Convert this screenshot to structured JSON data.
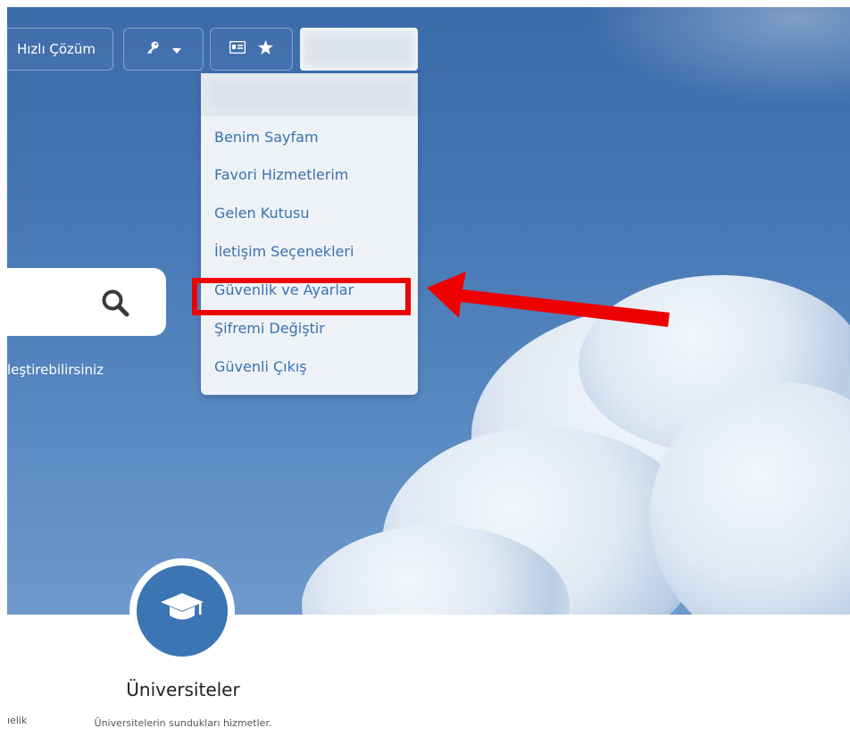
{
  "topbar": {
    "quick_solution_label": "Hızlı Çözüm",
    "key_icon": "key-icon",
    "caret_icon": "caret-down-icon",
    "id_card_icon": "id-card-icon",
    "star_icon": "star-icon"
  },
  "dropdown": {
    "items": [
      {
        "label": "Benim Sayfam"
      },
      {
        "label": "Favori Hizmetlerim"
      },
      {
        "label": "Gelen Kutusu"
      },
      {
        "label": "İletişim Seçenekleri"
      },
      {
        "label": "Güvenlik ve Ayarlar"
      },
      {
        "label": "Şifremi Değiştir"
      },
      {
        "label": "Güvenli Çıkış"
      }
    ],
    "highlighted_item": "Güvenlik ve Ayarlar"
  },
  "search": {
    "icon": "search-icon"
  },
  "hero": {
    "subtext_fragment": "leştirebilirsiniz"
  },
  "universities": {
    "icon": "graduation-cap-icon",
    "title": "Üniversiteler",
    "description": "Üniversitelerin sundukları hizmetler.",
    "left_fragment": "ıelik"
  },
  "colors": {
    "link_blue": "#3c72ad",
    "highlight_red": "#ee0000",
    "circle_blue": "#3b75b4"
  }
}
